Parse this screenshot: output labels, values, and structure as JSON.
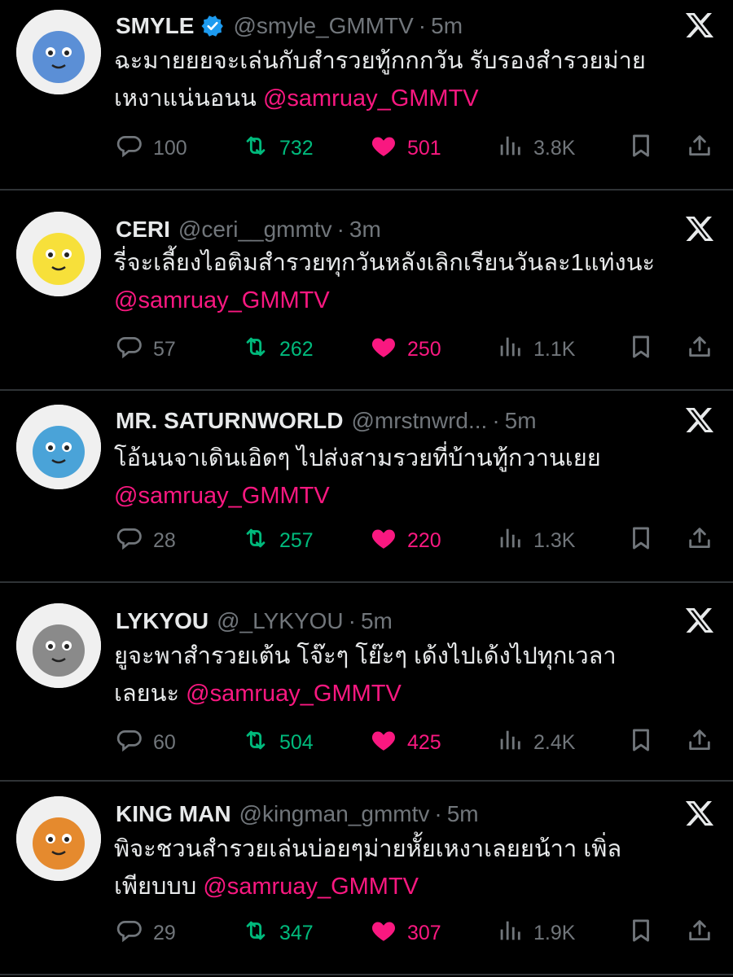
{
  "tweets": [
    {
      "name": "SMYLE",
      "verified": true,
      "handle": "@smyle_GMMTV",
      "time": "5m",
      "text_line1": "ฉะมายยยจะเล่นกับสำรวยทู้กกกวัน รับรองสำรวยม่าย",
      "text_line2_prefix": "เหงาแน่นอนน ",
      "mention": "@samruay_GMMTV",
      "replies": "100",
      "retweets": "732",
      "likes": "501",
      "views": "3.8K",
      "avatar_color": "#5b8fd6"
    },
    {
      "name": "CERI",
      "verified": false,
      "handle": "@ceri__gmmtv",
      "time": "3m",
      "text_line1": "รี่จะเลี้ยงไอติมสำรวยทุกวันหลังเลิกเรียนวันละ1แท่งนะ",
      "text_line2_prefix": "",
      "mention": "@samruay_GMMTV",
      "replies": "57",
      "retweets": "262",
      "likes": "250",
      "views": "1.1K",
      "avatar_color": "#f7e03a"
    },
    {
      "name": "MR. SATURNWORLD",
      "verified": false,
      "handle": "@mrstnwrd...",
      "time": "5m",
      "text_line1": "โอ้นนจาเดินเอิดๆ ไปส่งสามรวยที่บ้านทู้กวานเยย",
      "text_line2_prefix": "",
      "mention": "@samruay_GMMTV",
      "replies": "28",
      "retweets": "257",
      "likes": "220",
      "views": "1.3K",
      "avatar_color": "#4aa3d8"
    },
    {
      "name": "LYKYOU",
      "verified": false,
      "handle": "@_LYKYOU",
      "time": "5m",
      "text_line1": "ยูจะพาสำรวยเต้น โจ๊ะๆ โย๊ะๆ เด้งไปเด้งไปทุกเวลา",
      "text_line2_prefix": "เลยนะ ",
      "mention": "@samruay_GMMTV",
      "replies": "60",
      "retweets": "504",
      "likes": "425",
      "views": "2.4K",
      "avatar_color": "#8a8a8a"
    },
    {
      "name": "KING MAN",
      "verified": false,
      "handle": "@kingman_gmmtv",
      "time": "5m",
      "text_line1": "พิจะชวนสำรวยเล่นบ่อยๆม่ายหั้ยเหงาเลยยน้าา เพิ่ล",
      "text_line2_prefix": "เพียบบบ ",
      "mention": "@samruay_GMMTV",
      "replies": "29",
      "retweets": "347",
      "likes": "307",
      "views": "1.9K",
      "avatar_color": "#e58a2e"
    }
  ],
  "colors": {
    "background": "#000000",
    "text": "#e7e9ea",
    "muted": "#71767b",
    "retweet": "#00ba7c",
    "like": "#f91880",
    "mention": "#f91880",
    "verified": "#1d9bf0",
    "divider": "#2f3336"
  },
  "icons": [
    "reply-icon",
    "retweet-icon",
    "like-icon",
    "views-icon",
    "bookmark-icon",
    "share-icon",
    "x-logo-icon",
    "verified-badge-icon"
  ]
}
